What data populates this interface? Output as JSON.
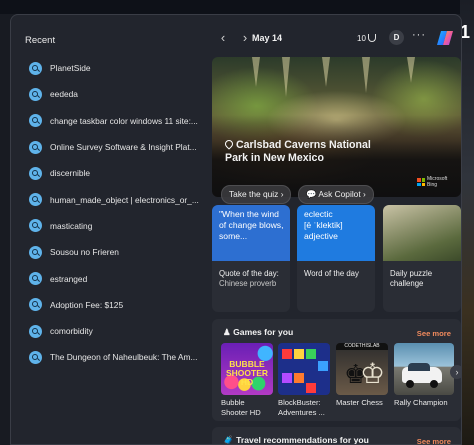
{
  "recent": {
    "title": "Recent",
    "items": [
      {
        "label": "PlanetSide"
      },
      {
        "label": "eededa"
      },
      {
        "label": "change taskbar color windows 11 site:..."
      },
      {
        "label": "Online Survey Software & Insight Plat..."
      },
      {
        "label": "discernible"
      },
      {
        "label": "human_made_object | electronics_or_..."
      },
      {
        "label": "masticating"
      },
      {
        "label": "Sousou no Frieren"
      },
      {
        "label": "estranged"
      },
      {
        "label": "Adoption Fee: $125"
      },
      {
        "label": "comorbidity"
      },
      {
        "label": "The Dungeon of Naheulbeuk: The Am..."
      }
    ]
  },
  "topbar": {
    "date": "May 14",
    "points": "10",
    "avatar": "D",
    "more": "···"
  },
  "hero": {
    "title": "Carlsbad Caverns National Park in New Mexico",
    "quiz_label": "Take the quiz",
    "copilot_label": "Ask Copilot",
    "bing_label": "Microsoft Bing"
  },
  "cards": [
    {
      "body": "\"When the wind of change blows, some...",
      "label": "Quote of the day:",
      "sub": "Chinese proverb"
    },
    {
      "body": "eclectic\n[ē ˈklektik]\nadjective",
      "label": "Word of the day",
      "sub": ""
    },
    {
      "body": "",
      "label": "Daily puzzle",
      "sub": "challenge"
    }
  ],
  "games": {
    "title": "Games for you",
    "see_more": "See more",
    "items": [
      {
        "name": "Bubble Shooter HD",
        "thumb_text": "BUBBLE SHOOTER HD"
      },
      {
        "name": "BlockBuster: Adventures ...",
        "thumb_text": ""
      },
      {
        "name": "Master Chess",
        "thumb_text": "CODETHISLAB"
      },
      {
        "name": "Rally Champion",
        "thumb_text": ""
      }
    ]
  },
  "travel": {
    "title": "Travel recommendations for you",
    "see_more": "See more"
  },
  "colors": {
    "accent_link": "#f08a5d",
    "quote_card": "#2d6fd1",
    "word_card": "#1f7be0",
    "search_bubble": "#5fb3ea"
  }
}
